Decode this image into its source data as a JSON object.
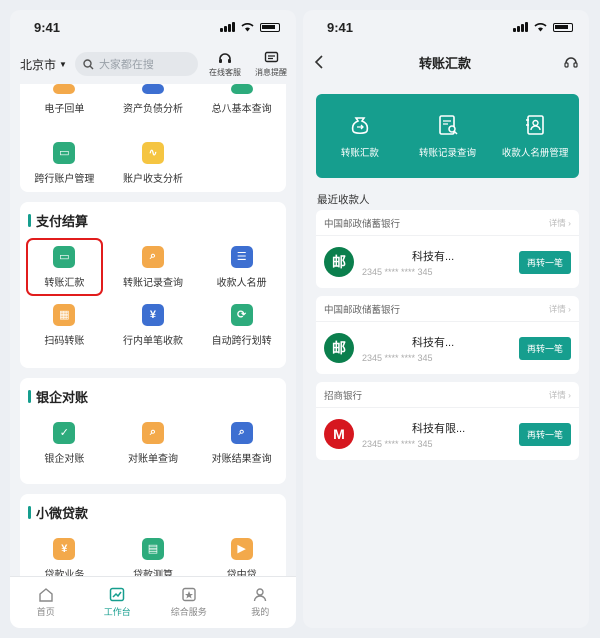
{
  "left": {
    "status_time": "9:41",
    "city": "北京市",
    "search_placeholder": "大家都在搜",
    "online_service": "在线客服",
    "message_alert": "消息提醒",
    "top_grid": {
      "partial_row": [
        "电子回单",
        "资产负债分析",
        "总八基本查询"
      ],
      "row2": [
        "跨行账户管理",
        "账户收支分析"
      ]
    },
    "payment": {
      "title": "支付结算",
      "items": [
        "转账汇款",
        "转账记录查询",
        "收款人名册",
        "扫码转账",
        "行内单笔收款",
        "自动跨行划转"
      ]
    },
    "reconcile": {
      "title": "银企对账",
      "items": [
        "银企对账",
        "对账单查询",
        "对账结果查询"
      ]
    },
    "loan": {
      "title": "小微贷款",
      "items": [
        "贷款业务",
        "贷款测算",
        "贷中贷"
      ]
    },
    "tabs": [
      "首页",
      "工作台",
      "综合服务",
      "我的"
    ]
  },
  "right": {
    "status_time": "9:41",
    "title": "转账汇款",
    "banner": [
      "转账汇款",
      "转账记录查询",
      "收款人名册管理"
    ],
    "recent_label": "最近收款人",
    "detail_label": "详情",
    "again_label": "再转一笔",
    "payees": [
      {
        "bank": "中国邮政储蓄银行",
        "name": "科技有...",
        "account": "2345 **** **** 345"
      },
      {
        "bank": "中国邮政储蓄银行",
        "name": "科技有...",
        "account": "2345 **** **** 345"
      },
      {
        "bank": "招商银行",
        "name": "科技有限...",
        "account": "2345 **** **** 345"
      }
    ]
  },
  "colors": {
    "accent": "#169e8e",
    "highlight": "#e11c1c"
  }
}
